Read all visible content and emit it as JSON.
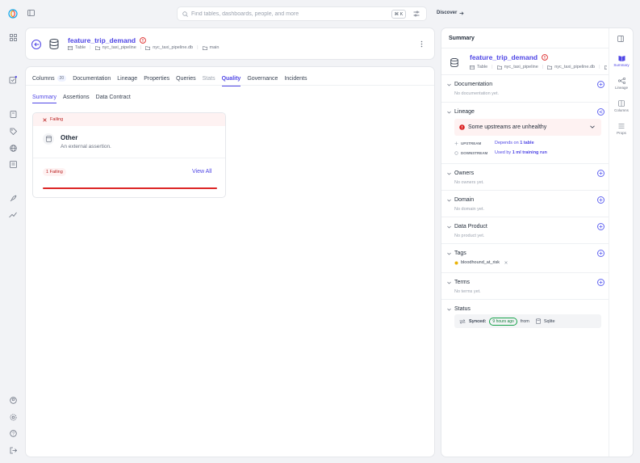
{
  "search": {
    "placeholder": "Find tables, dashboards, people, and more",
    "shortcut": "⌘ K"
  },
  "topbar": {
    "discover_label": "Discover"
  },
  "asset": {
    "name": "feature_trip_demand",
    "type": "Table",
    "breadcrumbs": [
      "nyc_taxi_pipeline",
      "nyc_taxi_pipeline.db",
      "main"
    ]
  },
  "tabs": [
    {
      "label": "Columns",
      "count": "20"
    },
    {
      "label": "Documentation"
    },
    {
      "label": "Lineage"
    },
    {
      "label": "Properties"
    },
    {
      "label": "Queries"
    },
    {
      "label": "Stats"
    },
    {
      "label": "Quality"
    },
    {
      "label": "Governance"
    },
    {
      "label": "Incidents"
    }
  ],
  "subtabs": [
    "Summary",
    "Assertions",
    "Data Contract"
  ],
  "quality": {
    "status": "Failing",
    "category_title": "Other",
    "category_desc": "An external assertion.",
    "failing_badge": "1 Failing",
    "view_all": "View All",
    "fail_fraction": 1.0
  },
  "panel": {
    "title": "Summary",
    "asset_name": "feature_trip_demand",
    "asset_type": "Table",
    "breadcrumbs": [
      "nyc_taxi_pipeline",
      "nyc_taxi_pipeline.db"
    ],
    "documentation": {
      "label": "Documentation",
      "empty": "No documentation yet."
    },
    "lineage": {
      "label": "Lineage",
      "alert": "Some upstreams are unhealthy",
      "upstream_label": "UPSTREAM",
      "upstream_text": "Depends on",
      "upstream_count": "1 table",
      "downstream_label": "DOWNSTREAM",
      "downstream_text": "Used by",
      "downstream_count": "1 ml training run"
    },
    "owners": {
      "label": "Owners",
      "empty": "No owners yet."
    },
    "domain": {
      "label": "Domain",
      "empty": "No domain yet."
    },
    "data_product": {
      "label": "Data Product",
      "empty": "No product yet."
    },
    "tags": {
      "label": "Tags",
      "items": [
        "bloodhound_at_risk"
      ]
    },
    "terms": {
      "label": "Terms",
      "empty": "No terms yet."
    },
    "status": {
      "label": "Status",
      "synced_label": "Synced:",
      "synced_time": "9 hours ago",
      "from": "from",
      "source": "Sqlite"
    }
  },
  "rail": [
    "Summary",
    "Lineage",
    "Columns",
    "Props"
  ],
  "colors": {
    "accent": "#4f46e5",
    "danger": "#dc2626",
    "danger_bg": "#fef2f2",
    "link": "#6366f1"
  }
}
